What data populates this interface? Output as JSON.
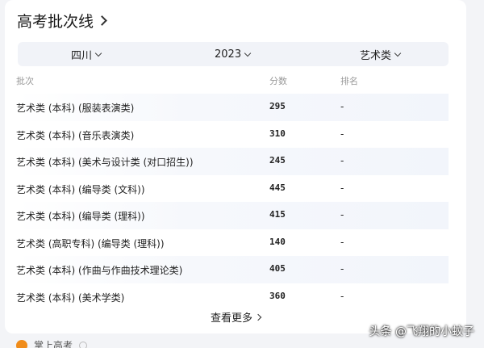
{
  "card": {
    "title": "高考批次线"
  },
  "filters": {
    "province": "四川",
    "year": "2023",
    "category": "艺术类"
  },
  "table": {
    "headers": {
      "batch": "批次",
      "score": "分数",
      "rank": "排名"
    },
    "rows": [
      {
        "batch": "艺术类 (本科) (服装表演类)",
        "score": "295",
        "rank": "-"
      },
      {
        "batch": "艺术类 (本科) (音乐表演类)",
        "score": "310",
        "rank": "-"
      },
      {
        "batch": "艺术类 (本科) (美术与设计类 (对口招生))",
        "score": "245",
        "rank": "-"
      },
      {
        "batch": "艺术类 (本科) (编导类 (文科))",
        "score": "445",
        "rank": "-"
      },
      {
        "batch": "艺术类 (本科) (编导类 (理科))",
        "score": "415",
        "rank": "-"
      },
      {
        "batch": "艺术类 (高职专科) (编导类 (理科))",
        "score": "140",
        "rank": "-"
      },
      {
        "batch": "艺术类 (本科) (作曲与作曲技术理论类)",
        "score": "405",
        "rank": "-"
      },
      {
        "batch": "艺术类 (本科) (美术学类)",
        "score": "360",
        "rank": "-"
      }
    ]
  },
  "more_label": "查看更多",
  "source": {
    "name": "掌上高考"
  },
  "watermark": "头条 @飞翔的小蚊子",
  "colors": {
    "accent": "#f08c1a",
    "filter_bg": "#f1f3f8"
  }
}
